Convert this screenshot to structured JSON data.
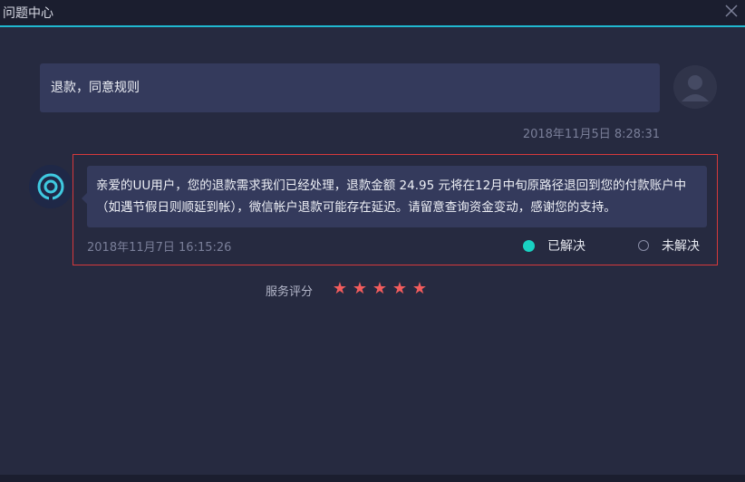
{
  "window": {
    "title": "问题中心"
  },
  "user_message": {
    "text": "退款，同意规则",
    "time": "2018年11月5日 8:28:31"
  },
  "agent_message": {
    "text": "亲爱的UU用户，您的退款需求我们已经处理，退款金额 24.95 元将在12月中旬原路径退回到您的付款账户中（如遇节假日则顺延到帐），微信帐户退款可能存在延迟。请留意查询资金变动，感谢您的支持。",
    "time": "2018年11月7日 16:15:26",
    "options": {
      "resolved": "已解决",
      "unresolved": "未解决",
      "selected": "resolved"
    }
  },
  "rating": {
    "label": "服务评分",
    "stars": 5,
    "max_stars": 5
  },
  "colors": {
    "accent": "#20b8d0",
    "highlight_border": "#d6393b",
    "star": "#f25c5c",
    "selected_radio": "#19d1c2"
  },
  "icons": {
    "close": "close-icon",
    "user_avatar": "user-avatar-icon",
    "agent_avatar": "uu-logo-icon",
    "star": "star-icon"
  }
}
